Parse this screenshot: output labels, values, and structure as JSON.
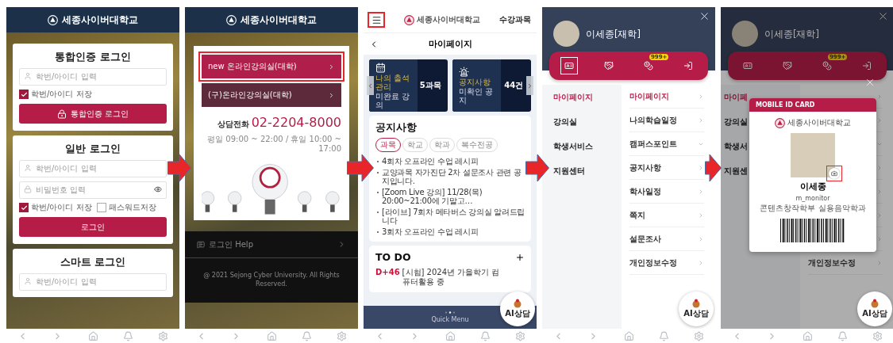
{
  "screens": [
    {
      "kind": "login",
      "header_title": "세종사이버대학교",
      "cards": [
        {
          "title": "통합인증 로그인",
          "fields": [
            {
              "kind": "id",
              "placeholder": "학번/아이디 입력"
            }
          ],
          "checkboxes": [
            {
              "label": "학번/아이디 저장",
              "checked": true
            }
          ],
          "button": {
            "kind": "certificate",
            "label": "통합인증 로그인"
          }
        },
        {
          "title": "일반 로그인",
          "fields": [
            {
              "kind": "id",
              "placeholder": "학번/아이디 입력"
            },
            {
              "kind": "password",
              "placeholder": "비밀번호 입력"
            }
          ],
          "checkboxes": [
            {
              "label": "학번/아이디 저장",
              "checked": true
            },
            {
              "label": "패스워드저장",
              "checked": false
            }
          ],
          "button": {
            "kind": "plain",
            "label": "로그인"
          }
        },
        {
          "title": "스마트 로그인",
          "fields": [
            {
              "kind": "id",
              "placeholder": "학번/아이디 입력"
            }
          ]
        }
      ]
    },
    {
      "kind": "classroom",
      "header_title": "세종사이버대학교",
      "links": [
        {
          "label": "new 온라인강의실(대학)",
          "highlighted": true
        },
        {
          "label": "(구)온라인강의실(대학)",
          "highlighted": false
        }
      ],
      "phone_label": "상담전화",
      "phone": "02-2204-8000",
      "hours": "평일 09:00 ~ 22:00 / 휴일 10:00 ~ 17:00",
      "help": "로그인 Help",
      "copyright": "@ 2021 Sejong Cyber University. All Rights Reserved."
    },
    {
      "kind": "mypage",
      "menu_highlighted": true,
      "logo_title": "세종사이버대학교",
      "top_link": "수강과목",
      "page_title": "마이페이지",
      "summary": [
        {
          "kind": "calendar",
          "label": "나의 출석관리",
          "title": "미완료 강의",
          "count": "5과목"
        },
        {
          "kind": "alarm",
          "label": "공지사항",
          "title": "미확인 공지",
          "count": "44건"
        }
      ],
      "notices": {
        "title": "공지사항",
        "tabs": [
          {
            "label": "과목",
            "selected": true
          },
          {
            "label": "학교",
            "selected": false
          },
          {
            "label": "학과",
            "selected": false
          },
          {
            "label": "복수전공",
            "selected": false
          }
        ],
        "items": [
          "4회차 오프라인 수업 레시피",
          "교양과목 자가진단 2차 설문조사 관련 공지입니다.",
          "[Zoom Live 강의] 11/28(목) 20:00~21:00에 기말고…",
          "[라이브] 7회차 메타버스 강의실 알려드립니다",
          "3회차 오프라인 수업 레시피"
        ]
      },
      "todo": {
        "title": "TO DO",
        "items": [
          {
            "dday": "D+46",
            "text": "[시험] 2024년 가을학기 컴퓨터활용 중"
          }
        ]
      },
      "quick_menu": "Quick Menu",
      "ai_button": "AI상담"
    },
    {
      "kind": "drawer",
      "user": "이세종[재학]",
      "icons": [
        {
          "kind": "id-card",
          "selected": true
        },
        {
          "kind": "handshake",
          "selected": false
        },
        {
          "kind": "coins",
          "selected": false,
          "badge": "999+"
        },
        {
          "kind": "logout",
          "selected": false
        }
      ],
      "left_menu": [
        {
          "label": "마이페이지",
          "selected": true
        },
        {
          "label": "강의실",
          "selected": false
        },
        {
          "label": "학생서비스",
          "selected": false
        },
        {
          "label": "지원센터",
          "selected": false
        }
      ],
      "sub_menu": [
        {
          "kind": "link",
          "label": "마이페이지",
          "selected": true
        },
        {
          "kind": "link",
          "label": "나의학습일정",
          "selected": false
        },
        {
          "kind": "group",
          "label": "캠퍼스포인트",
          "selected": false
        },
        {
          "kind": "link",
          "label": "공지사항",
          "selected": false
        },
        {
          "kind": "link",
          "label": "학사일정",
          "selected": false
        },
        {
          "kind": "link",
          "label": "쪽지",
          "selected": false
        },
        {
          "kind": "link",
          "label": "설문조사",
          "selected": false
        },
        {
          "kind": "link",
          "label": "개인정보수정",
          "selected": false
        }
      ],
      "ai_button": "AI상담"
    },
    {
      "kind": "drawer",
      "user": "이세종[재학]",
      "icons": [
        {
          "kind": "id-card",
          "selected": false
        },
        {
          "kind": "handshake",
          "selected": false
        },
        {
          "kind": "coins",
          "selected": false,
          "badge": "999+"
        },
        {
          "kind": "logout",
          "selected": false
        }
      ],
      "left_menu": [
        {
          "label": "마이페",
          "selected": true
        },
        {
          "label": "강의실",
          "selected": false
        },
        {
          "label": "학생서",
          "selected": false
        },
        {
          "label": "지원센",
          "selected": false
        }
      ],
      "sub_menu": [
        {
          "kind": "covered"
        },
        {
          "kind": "covered"
        },
        {
          "kind": "covered_group"
        },
        {
          "kind": "covered"
        },
        {
          "kind": "covered"
        },
        {
          "kind": "covered"
        },
        {
          "kind": "covered"
        },
        {
          "kind": "link",
          "label": "개인정보수정",
          "selected": false
        }
      ],
      "ai_button": "AI상담",
      "id_card": {
        "header": "MOBILE ID CARD",
        "logo_title": "세종사이버대학교",
        "name": "이세종",
        "user_id": "m_monitor",
        "department": "콘텐츠창작학부 실용음악학과",
        "camera_highlighted": true
      }
    }
  ]
}
